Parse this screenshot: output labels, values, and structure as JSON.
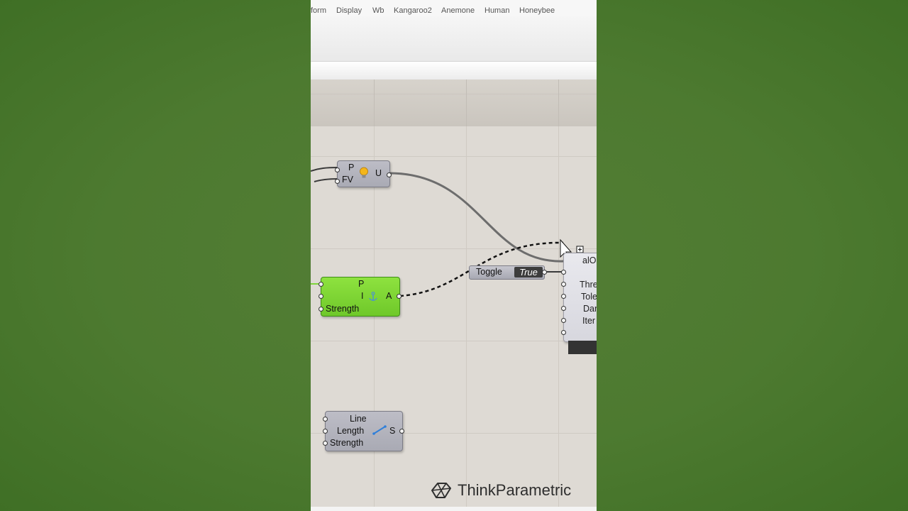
{
  "menu": {
    "items": [
      "form",
      "Display",
      "Wb",
      "Kangaroo2",
      "Anemone",
      "Human",
      "Honeybee"
    ]
  },
  "components": {
    "unary": {
      "inputs": [
        "P",
        "FV"
      ],
      "output": "U",
      "icon": "lightbulb-icon"
    },
    "anchor": {
      "inputs": [
        "P",
        "I",
        "Strength"
      ],
      "output": "A",
      "icon": "anchor-icon"
    },
    "length": {
      "inputs": [
        "Line",
        "Length",
        "Strength"
      ],
      "output": "S",
      "icon": "line-length-icon"
    },
    "toggle": {
      "label": "Toggle",
      "value": "True"
    },
    "solver": {
      "header": "alO",
      "inputs": [
        "Thre",
        "Tole",
        "Dar",
        "Iter"
      ]
    }
  },
  "watermark": {
    "brand": "ThinkParametric",
    "icon": "thinkparametric-logo-icon"
  },
  "colors": {
    "background": "#4d7a30",
    "canvas": "#dedad4",
    "component": "#adaeb8",
    "green_component": "#7ed43a"
  }
}
